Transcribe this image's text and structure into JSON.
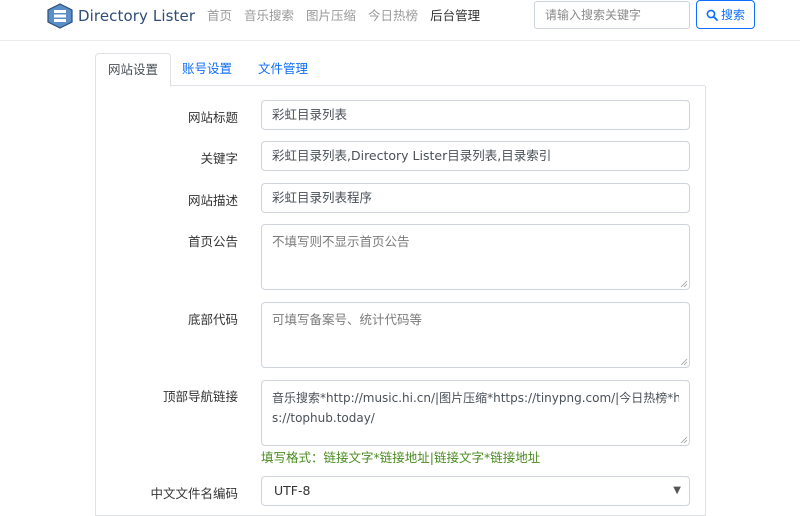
{
  "navbar": {
    "brand": "Directory Lister",
    "items": [
      {
        "label": "首页"
      },
      {
        "label": "音乐搜索"
      },
      {
        "label": "图片压缩"
      },
      {
        "label": "今日热榜"
      },
      {
        "label": "后台管理"
      }
    ],
    "search_placeholder": "请输入搜索关键字",
    "search_button": "搜索"
  },
  "tabs": [
    {
      "label": "网站设置"
    },
    {
      "label": "账号设置"
    },
    {
      "label": "文件管理"
    }
  ],
  "form": {
    "site_title": {
      "label": "网站标题",
      "value": "彩虹目录列表"
    },
    "keywords": {
      "label": "关键字",
      "value": "彩虹目录列表,Directory Lister目录列表,目录索引"
    },
    "description": {
      "label": "网站描述",
      "value": "彩虹目录列表程序"
    },
    "announcement": {
      "label": "首页公告",
      "placeholder": "不填写则不显示首页公告"
    },
    "footer_code": {
      "label": "底部代码",
      "placeholder": "可填写备案号、统计代码等"
    },
    "top_nav": {
      "label": "顶部导航链接",
      "value_line1": "音乐搜索*http://music.hi.cn/|图片压缩*https://tinypng.com/|今日热榜*http",
      "value_line2": "s://tophub.today/",
      "hint": "填写格式：链接文字*链接地址|链接文字*链接地址"
    },
    "encoding": {
      "label": "中文文件名编码",
      "value": "UTF-8"
    }
  },
  "colors": {
    "accent": "#0d6efd",
    "brand": "#2f4d76",
    "hint": "#4a8b1f"
  }
}
